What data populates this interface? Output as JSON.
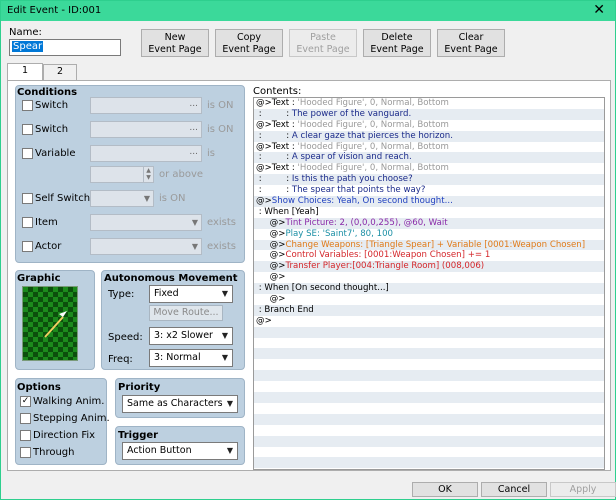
{
  "window": {
    "title": "Edit Event - ID:001",
    "close_glyph": "✕"
  },
  "name": {
    "label": "Name:",
    "value": "Spear"
  },
  "toolbar": {
    "new_l1": "New",
    "new_l2": "Event Page",
    "copy_l1": "Copy",
    "copy_l2": "Event Page",
    "paste_l1": "Paste",
    "paste_l2": "Event Page",
    "delete_l1": "Delete",
    "delete_l2": "Event Page",
    "clear_l1": "Clear",
    "clear_l2": "Event Page"
  },
  "tabs": [
    "1",
    "2"
  ],
  "conditions": {
    "title": "Conditions",
    "switch1": "Switch",
    "switch2": "Switch",
    "variable": "Variable",
    "self_switch": "Self Switch",
    "item": "Item",
    "actor": "Actor",
    "is_on": "is ON",
    "is": "is",
    "or_above": "or above",
    "exists": "exists",
    "dots": "..."
  },
  "graphic": {
    "title": "Graphic"
  },
  "movement": {
    "title": "Autonomous Movement",
    "type_label": "Type:",
    "type_value": "Fixed",
    "move_route": "Move Route...",
    "speed_label": "Speed:",
    "speed_value": "3: x2 Slower",
    "freq_label": "Freq:",
    "freq_value": "3: Normal"
  },
  "options": {
    "title": "Options",
    "walking": "Walking Anim.",
    "stepping": "Stepping Anim.",
    "direction": "Direction Fix",
    "through": "Through",
    "walking_checked": true,
    "check_glyph": "✓"
  },
  "priority": {
    "title": "Priority",
    "value": "Same as Characters"
  },
  "trigger": {
    "title": "Trigger",
    "value": "Action Button"
  },
  "contents": {
    "label": "Contents:",
    "lines": [
      {
        "p": "@>Text : ",
        "t": "'Hooded Figure', 0, Normal, Bottom",
        "c": "c-gray"
      },
      {
        "p": " :         : ",
        "t": "The power of the vanguard.",
        "c": "c-navy"
      },
      {
        "p": "@>Text : ",
        "t": "'Hooded Figure', 0, Normal, Bottom",
        "c": "c-gray"
      },
      {
        "p": " :         : ",
        "t": "A clear gaze that pierces the horizon.",
        "c": "c-navy"
      },
      {
        "p": "@>Text : ",
        "t": "'Hooded Figure', 0, Normal, Bottom",
        "c": "c-gray"
      },
      {
        "p": " :         : ",
        "t": "A spear of vision and reach.",
        "c": "c-navy"
      },
      {
        "p": "@>Text : ",
        "t": "'Hooded Figure', 0, Normal, Bottom",
        "c": "c-gray"
      },
      {
        "p": " :         : ",
        "t": "Is this the path you choose?",
        "c": "c-navy"
      },
      {
        "p": " :         : ",
        "t": "The spear that points the way?",
        "c": "c-navy"
      },
      {
        "p": "@>",
        "t": "Show Choices: Yeah, On second thought...",
        "c": "c-blue"
      },
      {
        "p": " : ",
        "t": "When [Yeah]",
        "c": "c-black"
      },
      {
        "p": "     @>",
        "t": "Tint Picture: 2, (0,0,0,255), @60, Wait",
        "c": "c-purple"
      },
      {
        "p": "     @>",
        "t": "Play SE: 'Saint7', 80, 100",
        "c": "c-teal"
      },
      {
        "p": "     @>",
        "t": "Change Weapons: [Triangle Spear] + Variable [0001:Weapon Chosen]",
        "c": "c-orange"
      },
      {
        "p": "     @>",
        "t": "Control Variables: [0001:Weapon Chosen] += 1",
        "c": "c-red"
      },
      {
        "p": "     @>",
        "t": "Transfer Player:[004:Triangle Room] (008,006)",
        "c": "c-red"
      },
      {
        "p": "     @>",
        "t": "",
        "c": "c-black"
      },
      {
        "p": " : ",
        "t": "When [On second thought...]",
        "c": "c-black"
      },
      {
        "p": "     @>",
        "t": "",
        "c": "c-black"
      },
      {
        "p": " : ",
        "t": "Branch End",
        "c": "c-black"
      },
      {
        "p": "@>",
        "t": "",
        "c": "c-black"
      }
    ]
  },
  "footer": {
    "ok": "OK",
    "cancel": "Cancel",
    "apply": "Apply"
  }
}
